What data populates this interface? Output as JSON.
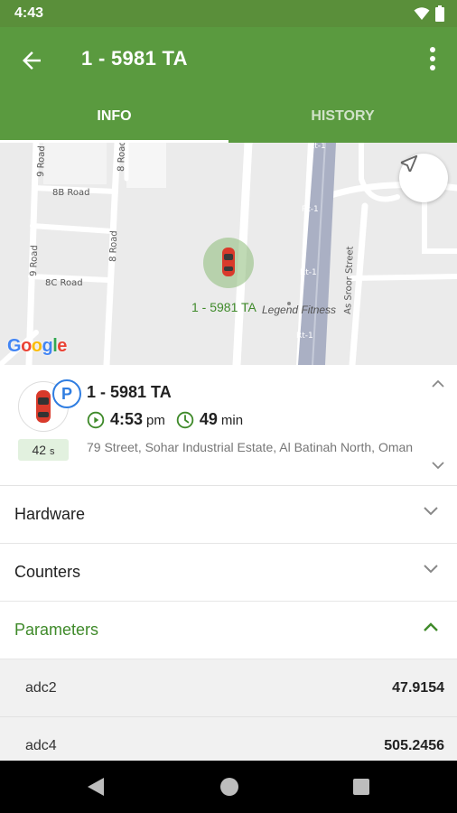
{
  "status_bar": {
    "time": "4:43"
  },
  "app_bar": {
    "title": "1 - 5981 TA"
  },
  "tabs": [
    {
      "label": "INFO",
      "active": true
    },
    {
      "label": "HISTORY",
      "active": false
    }
  ],
  "map": {
    "marker_label": "1 - 5981 TA",
    "poi_label": "Legend Fitness",
    "streets": [
      "9 Road",
      "8 Road",
      "8B Road",
      "9 Road",
      "8 Road",
      "8C Road",
      "As Sroor Street",
      "Rt-1",
      "Rt-1",
      "Rt-1",
      "Rt-1"
    ],
    "attribution": [
      "G",
      "o",
      "o",
      "g",
      "l",
      "e"
    ]
  },
  "vehicle": {
    "name": "1 - 5981 TA",
    "parking_badge": "P",
    "seconds_value": "42",
    "seconds_unit": "s",
    "time_value": "4:53",
    "time_unit": "pm",
    "duration_value": "49",
    "duration_unit": "min",
    "address": "79 Street, Sohar Industrial Estate, Al Batinah North, Oman"
  },
  "sections": [
    {
      "label": "Hardware",
      "expanded": false
    },
    {
      "label": "Counters",
      "expanded": false
    },
    {
      "label": "Parameters",
      "expanded": true
    }
  ],
  "parameters": [
    {
      "key": "adc2",
      "value": "47.9154"
    },
    {
      "key": "adc4",
      "value": "505.2456"
    }
  ],
  "colors": {
    "primary": "#5a9a3f",
    "accent_green": "#3f8a2a",
    "badge_blue": "#2f7de1"
  }
}
